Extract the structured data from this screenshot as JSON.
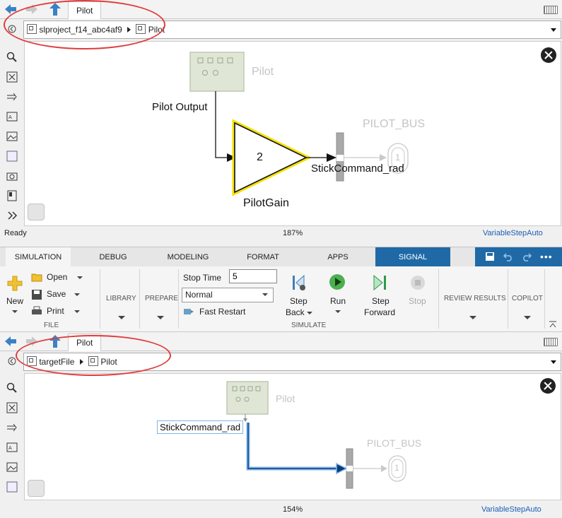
{
  "top_editor": {
    "tab_label": "Pilot",
    "breadcrumb": {
      "root": "slproject_f14_abc4af9",
      "child": "Pilot"
    },
    "diagram": {
      "subsystem_label": "Pilot",
      "port_label": "Pilot Output",
      "gain_value": "2",
      "gain_label": "PilotGain",
      "signal_label": "StickCommand_rad",
      "outport_number": "1",
      "outport_label": "PILOT_BUS"
    },
    "status": {
      "left": "Ready",
      "zoom": "187%",
      "solver": "VariableStepAuto"
    }
  },
  "ribbon": {
    "tabs": [
      "SIMULATION",
      "DEBUG",
      "MODELING",
      "FORMAT",
      "APPS",
      "SIGNAL"
    ],
    "active_tab": "SIGNAL",
    "file": {
      "new_label": "New",
      "open_label": "Open",
      "save_label": "Save",
      "print_label": "Print",
      "group_label": "FILE"
    },
    "library_label": "LIBRARY",
    "prepare_label": "PREPARE",
    "simulate": {
      "stop_time_label": "Stop Time",
      "stop_time_value": "5",
      "mode_value": "Normal",
      "fast_restart_label": "Fast Restart",
      "step_back_label_1": "Step",
      "step_back_label_2": "Back",
      "run_label": "Run",
      "step_forward_label_1": "Step",
      "step_forward_label_2": "Forward",
      "stop_label": "Stop",
      "group_label": "SIMULATE"
    },
    "review_results_label": "REVIEW RESULTS",
    "copilot_label": "COPILOT"
  },
  "bottom_editor": {
    "tab_label": "Pilot",
    "breadcrumb": {
      "root": "targetFile",
      "child": "Pilot"
    },
    "diagram": {
      "subsystem_label": "Pilot",
      "signal_label": "StickCommand_rad",
      "outport_number": "1",
      "outport_label": "PILOT_BUS"
    },
    "status": {
      "zoom": "154%",
      "solver": "VariableStepAuto"
    }
  },
  "colors": {
    "annotation_oval": "#e23b3b",
    "ribbon_active_tab": "#1f6aa6",
    "gain_highlight": "#f5e100",
    "selected_line": "#1a73c9"
  }
}
